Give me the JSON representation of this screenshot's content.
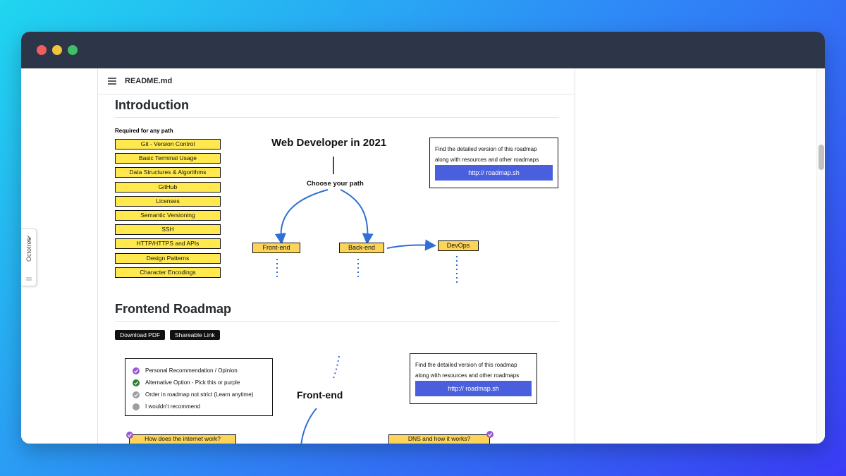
{
  "window": {
    "traffic_lights": [
      "close",
      "minimize",
      "maximize"
    ]
  },
  "readme": {
    "title": "README.md"
  },
  "sidebar_tab": {
    "label": "Octotree"
  },
  "intro": {
    "heading": "Introduction",
    "required_label": "Required for any path",
    "skills": [
      "Git - Version Control",
      "Basic Terminal Usage",
      "Data Structures & Algorithms",
      "GitHub",
      "Licenses",
      "Semantic Versioning",
      "SSH",
      "HTTP/HTTPS and APIs",
      "Design Patterns",
      "Character Encodings"
    ],
    "diagram_title": "Web Developer in 2021",
    "choose_label": "Choose your path",
    "paths": [
      "Front-end",
      "Back-end",
      "DevOps"
    ],
    "info_text_1": "Find the detailed version of this roadmap",
    "info_text_2": "along with resources and other roadmaps",
    "info_link": "http:// roadmap.sh"
  },
  "frontend": {
    "heading": "Frontend Roadmap",
    "buttons": [
      "Download PDF",
      "Shareable Link"
    ],
    "legend": [
      {
        "label": "Personal Recommendation / Opinion",
        "color": "#9b59d0"
      },
      {
        "label": "Alternative Option - Pick this or purple",
        "color": "#2e7d32"
      },
      {
        "label": "Order in roadmap not strict (Learn anytime)",
        "color": "#9e9e9e"
      },
      {
        "label": "I wouldn't recommend",
        "color": "#9e9e9e"
      }
    ],
    "diagram_title": "Front-end",
    "info_text_1": "Find the detailed version of this roadmap",
    "info_text_2": "along with resources and other roadmaps",
    "info_link": "http:// roadmap.sh",
    "bottom_nodes": [
      "How does the internet work?",
      "DNS and how it works?"
    ]
  },
  "colors": {
    "accent": "#4a5fde",
    "node_yellow": "#ffe94e",
    "titlebar": "#2d3648"
  }
}
